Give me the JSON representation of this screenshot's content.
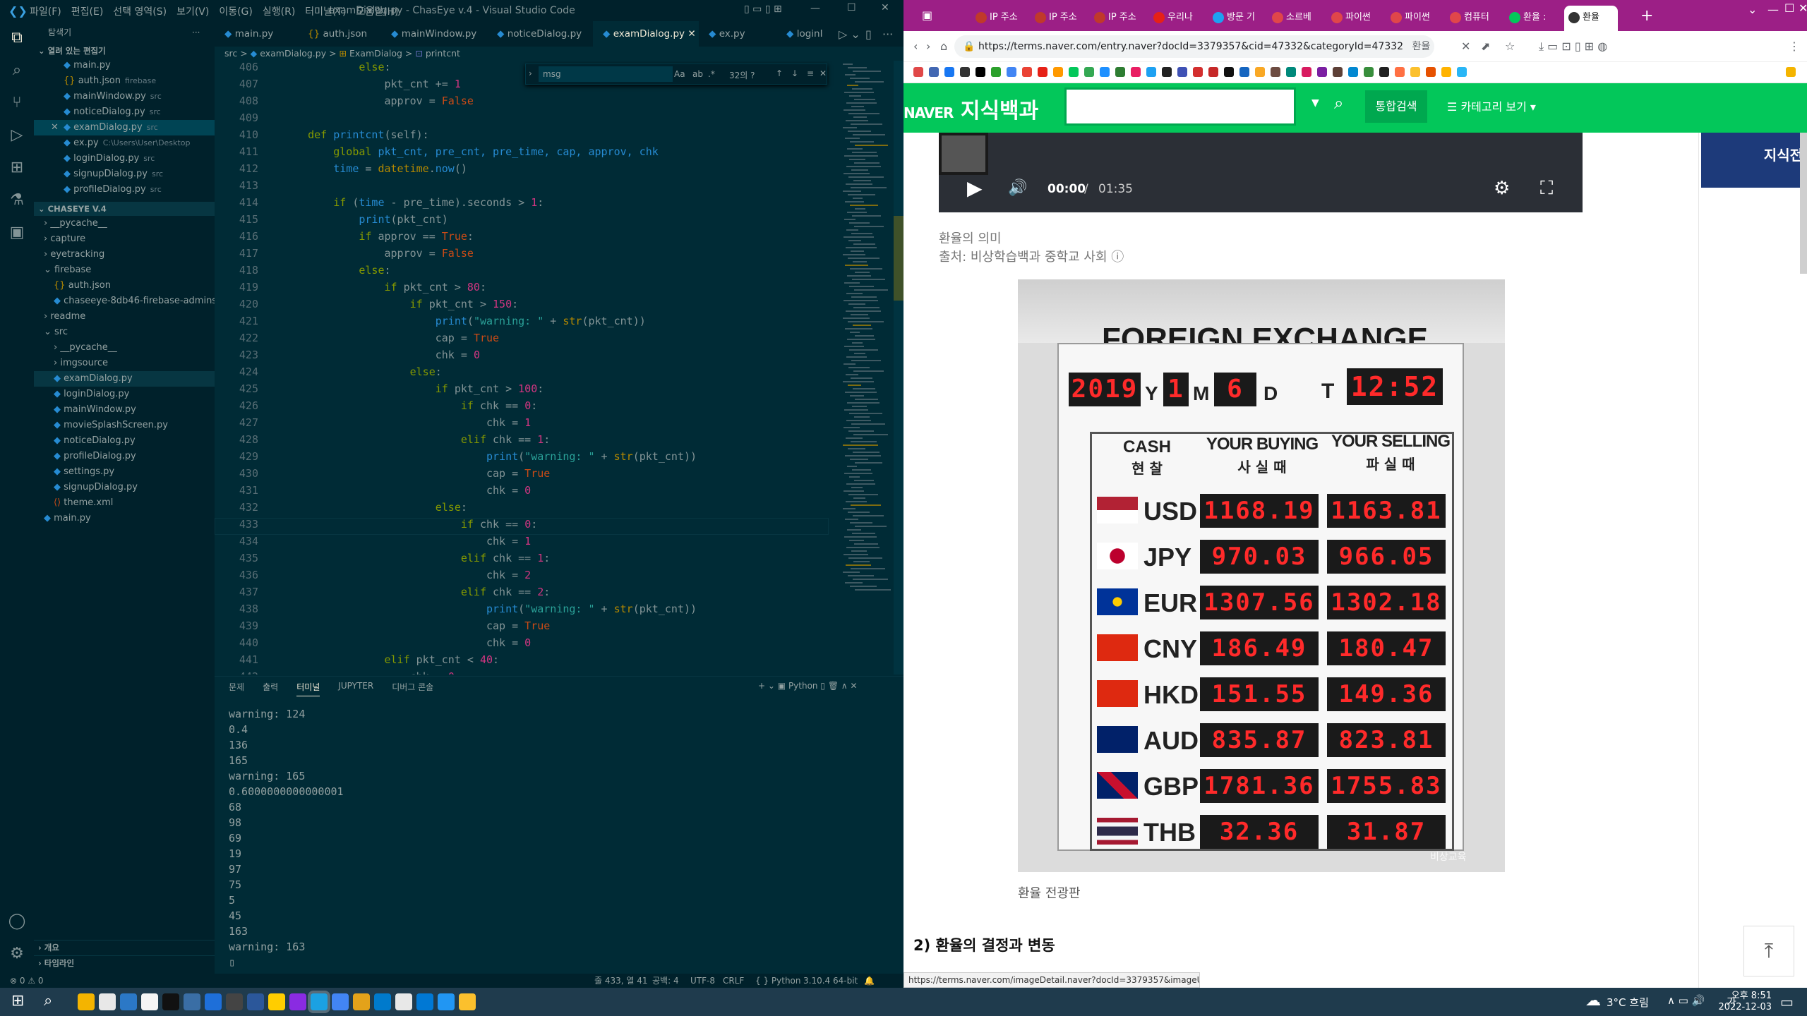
{
  "vscode": {
    "title": "examDialog.py - ChasEye v.4 - Visual Studio Code",
    "menu": [
      "파일(F)",
      "편집(E)",
      "선택 영역(S)",
      "보기(V)",
      "이동(G)",
      "실행(R)",
      "터미널(T)",
      "도움말(H)"
    ],
    "explorer_header": "탐색기",
    "open_editors_label": "열려 있는 편집기",
    "open_editors": [
      {
        "name": "main.py",
        "hint": ""
      },
      {
        "name": "auth.json",
        "hint": "firebase"
      },
      {
        "name": "mainWindow.py",
        "hint": "src"
      },
      {
        "name": "noticeDialog.py",
        "hint": "src"
      },
      {
        "name": "examDialog.py",
        "hint": "src"
      },
      {
        "name": "ex.py",
        "hint": "C:\\Users\\User\\Desktop"
      },
      {
        "name": "loginDialog.py",
        "hint": "src"
      },
      {
        "name": "signupDialog.py",
        "hint": "src"
      },
      {
        "name": "profileDialog.py",
        "hint": "src"
      }
    ],
    "project_label": "CHASEYE V.4",
    "tree": [
      {
        "name": "__pycache__",
        "depth": 1,
        "type": "folder"
      },
      {
        "name": "capture",
        "depth": 1,
        "type": "folder"
      },
      {
        "name": "eyetracking",
        "depth": 1,
        "type": "folder"
      },
      {
        "name": "firebase",
        "depth": 1,
        "type": "folder-open"
      },
      {
        "name": "auth.json",
        "depth": 2,
        "type": "file"
      },
      {
        "name": "chaseeye-8db46-firebase-adminsd...",
        "depth": 2,
        "type": "file"
      },
      {
        "name": "readme",
        "depth": 1,
        "type": "folder"
      },
      {
        "name": "src",
        "depth": 1,
        "type": "folder-open"
      },
      {
        "name": "__pycache__",
        "depth": 2,
        "type": "folder"
      },
      {
        "name": "imgsource",
        "depth": 2,
        "type": "folder"
      },
      {
        "name": "examDialog.py",
        "depth": 2,
        "type": "file"
      },
      {
        "name": "loginDialog.py",
        "depth": 2,
        "type": "file"
      },
      {
        "name": "mainWindow.py",
        "depth": 2,
        "type": "file"
      },
      {
        "name": "movieSplashScreen.py",
        "depth": 2,
        "type": "file"
      },
      {
        "name": "noticeDialog.py",
        "depth": 2,
        "type": "file"
      },
      {
        "name": "profileDialog.py",
        "depth": 2,
        "type": "file"
      },
      {
        "name": "settings.py",
        "depth": 2,
        "type": "file"
      },
      {
        "name": "signupDialog.py",
        "depth": 2,
        "type": "file"
      },
      {
        "name": "theme.xml",
        "depth": 2,
        "type": "file"
      },
      {
        "name": "main.py",
        "depth": 1,
        "type": "file"
      }
    ],
    "outline_label": "개요",
    "timeline_label": "타임라인",
    "tabs": [
      "main.py",
      "auth.json",
      "mainWindow.py",
      "noticeDialog.py",
      "examDialog.py",
      "ex.py",
      "loginI"
    ],
    "breadcrumb": [
      "src",
      "examDialog.py",
      "ExamDialog",
      "printcnt"
    ],
    "find": {
      "query": "msg",
      "result": "32의 ?"
    },
    "terminal_tabs": [
      "문제",
      "출력",
      "터미널",
      "JUPYTER",
      "디버그 콘솔"
    ],
    "terminal_shell": "Python",
    "terminal_output": [
      "warning: 124",
      "0.4",
      "136",
      "165",
      "warning: 165",
      "0.6000000000000001",
      "68",
      "98",
      "69",
      "19",
      "97",
      "75",
      "5",
      "45",
      "163",
      "warning: 163"
    ],
    "status": {
      "problems": "⊗ 0 ⚠ 0",
      "position": "줄 433, 열 41",
      "spaces": "공백: 4",
      "encoding": "UTF-8",
      "eol": "CRLF",
      "language": "Python",
      "interpreter": "3.10.4 64-bit"
    }
  },
  "browser": {
    "tabs": [
      "IP 주소",
      "IP 주소",
      "IP 주소",
      "우리나",
      "방문 기",
      "소르베",
      "파이썬",
      "파이썬",
      "컴퓨터",
      "환율 : ",
      "환율"
    ],
    "url": "https://terms.naver.com/entry.naver?docId=3379357&cid=47332&categoryId=47332",
    "url_suffix": "환율",
    "naver_logo": "NAVER",
    "naver_service": "지식백과",
    "search_button": "통합검색",
    "category_button": "카테고리 보기",
    "video": {
      "current": "00:00",
      "duration": "01:35"
    },
    "caption_title": "환율의 의미",
    "caption_source": "출처: 비상학습백과 중학교 사회",
    "board": {
      "title": "FOREIGN EXCHANGE RATE",
      "year": "2019",
      "month": "1",
      "day": "6",
      "time": "12:52",
      "date_labels": [
        "Y",
        "M",
        "D",
        "T"
      ],
      "col_cash_en": "CASH",
      "col_cash_kr": "현 찰",
      "col_buy_en": "YOUR BUYING",
      "col_buy_kr": "사 실 때",
      "col_sell_en": "YOUR SELLING",
      "col_sell_kr": "파 실 때",
      "watermark": "비상교육",
      "rates": [
        {
          "cur": "USD",
          "buy": "1168.19",
          "sell": "1163.81"
        },
        {
          "cur": "JPY",
          "buy": "970.03",
          "sell": "966.05"
        },
        {
          "cur": "EUR",
          "buy": "1307.56",
          "sell": "1302.18"
        },
        {
          "cur": "CNY",
          "buy": "186.49",
          "sell": "180.47"
        },
        {
          "cur": "HKD",
          "buy": "151.55",
          "sell": "149.36"
        },
        {
          "cur": "AUD",
          "buy": "835.87",
          "sell": "823.81"
        },
        {
          "cur": "GBP",
          "buy": "1781.36",
          "sell": "1755.83"
        },
        {
          "cur": "THB",
          "buy": "32.36",
          "sell": "31.87"
        }
      ]
    },
    "image_caption": "환율 전광판",
    "section_heading": "2) 환율의 결정과 변동",
    "link_preview": "https://terms.naver.com/imageDetail.naver?docId=3379357&imageUrl=htt...",
    "side_banner": "지식전"
  },
  "taskbar": {
    "weather": "3°C 흐림",
    "ime": "가",
    "time": "오후 8:51",
    "date": "2022-12-03"
  }
}
